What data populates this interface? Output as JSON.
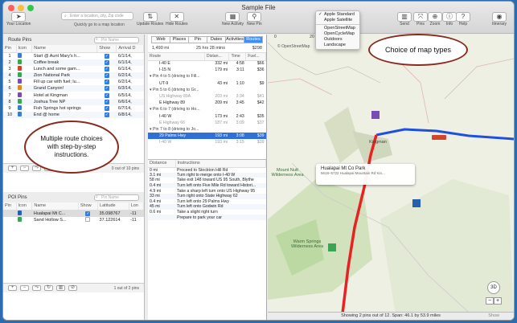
{
  "window": {
    "title": "Sample File"
  },
  "toolbar": {
    "your_location": "Your Location",
    "search_placeholder": "Enter a location, city, Zip code",
    "search_caption": "Quickly go to a map location",
    "update_routes": "Update Routes",
    "hide_routes": "Hide Routes",
    "new_activity": "New Activity",
    "new_pin": "New Pin",
    "send": "Send",
    "pins": "Pins",
    "zoom": "Zoom",
    "info": "Info",
    "help": "Help",
    "itinerary": "Itinerary"
  },
  "route_pins": {
    "title": "Route Pins",
    "search_placeholder": "Pin Name",
    "columns": [
      "Pin",
      "Icon",
      "Name",
      "Show",
      "Arrival D"
    ],
    "rows": [
      {
        "pin": "1",
        "name": "Start @ Aunt Mary's h...",
        "date": "6/1/14, ",
        "color": "#3a7bd5"
      },
      {
        "pin": "2",
        "name": "Coffee break",
        "date": "6/1/14, ",
        "color": "#3aa655"
      },
      {
        "pin": "3",
        "name": "Lunch and some gam...",
        "date": "6/1/14, ",
        "color": "#d2452c"
      },
      {
        "pin": "4",
        "name": "Zion National Park",
        "date": "6/2/14, ",
        "color": "#3aa655"
      },
      {
        "pin": "5",
        "name": "Fill up car with fuel; lu...",
        "date": "6/2/14, ",
        "color": "#7a4bb5"
      },
      {
        "pin": "6",
        "name": "Grand Canyon!",
        "date": "6/3/14, ",
        "color": "#e08a1e"
      },
      {
        "pin": "7",
        "name": "Hotel at Kingman",
        "date": "6/5/14, ",
        "color": "#7a4bb5"
      },
      {
        "pin": "8",
        "name": "Joshua Tree NP",
        "date": "6/6/14, ",
        "color": "#3aa655"
      },
      {
        "pin": "9",
        "name": "Fish Springs hot springs",
        "date": "6/7/14, ",
        "color": "#3a7bd5"
      },
      {
        "pin": "10",
        "name": "End @ home",
        "date": "6/8/14, ",
        "color": "#3a7bd5"
      }
    ],
    "footer": "0 out of 10 pins"
  },
  "poi_pins": {
    "title": "POI Pins",
    "search_placeholder": "Pin Name",
    "columns": [
      "Pin",
      "Icon",
      "Name",
      "Show",
      "Latitude",
      "Lon"
    ],
    "rows": [
      {
        "name": "Hualapai Mt C...",
        "lat": "35.098767",
        "lon": "-11"
      },
      {
        "name": "Sand Hollow S...",
        "lat": "37.122614",
        "lon": "-11"
      }
    ],
    "footer": "1 out of 2 pins"
  },
  "route_panel": {
    "tabs": [
      "Web",
      "Places",
      "Pin",
      "Dates",
      "Activities",
      "Routes"
    ],
    "active_tab": "Routes",
    "summary": {
      "miles": "1,490 mi",
      "time": "25 hrs 28 mins",
      "cost": "$298"
    },
    "columns": [
      "Route",
      "Distan...",
      "Time",
      "Fuel..."
    ],
    "rows": [
      {
        "type": "row",
        "route": "I-40 E",
        "dist": "332 mi",
        "time": "4:58",
        "fuel": "$66"
      },
      {
        "type": "row",
        "route": "I-15 N",
        "dist": "179 mi",
        "time": "3:11",
        "fuel": "$36"
      },
      {
        "type": "hdr",
        "route": "Pin 4 to 5 (driving to Fill..."
      },
      {
        "type": "row",
        "route": "UT-9",
        "dist": "43 mi",
        "time": "1:10",
        "fuel": "$9"
      },
      {
        "type": "hdr",
        "route": "Pin 5 to 6 (driving to Gr..."
      },
      {
        "type": "dim",
        "route": "US Highway 89A",
        "dist": "203 mi",
        "time": "3:34",
        "fuel": "$41"
      },
      {
        "type": "row",
        "route": "E Highway 89",
        "dist": "209 mi",
        "time": "3:45",
        "fuel": "$42"
      },
      {
        "type": "hdr",
        "route": "Pin 6 to 7 (driving to Ho..."
      },
      {
        "type": "row",
        "route": "I-40 W",
        "dist": "173 mi",
        "time": "2:43",
        "fuel": "$35"
      },
      {
        "type": "dim",
        "route": "E Highway 66",
        "dist": "187 mi",
        "time": "3:09",
        "fuel": "$37"
      },
      {
        "type": "hdr",
        "route": "Pin 7 to 8 (driving to Jo..."
      },
      {
        "type": "sel",
        "route": "29 Palms Hwy",
        "dist": "193 mi",
        "time": "3:08",
        "fuel": "$39"
      },
      {
        "type": "dim",
        "route": "I-40 W",
        "dist": "193 mi",
        "time": "3:15",
        "fuel": "$39"
      }
    ],
    "step_columns": [
      "Distance",
      "Instructions"
    ],
    "steps": [
      {
        "d": "0 mi",
        "i": "Proceed to Stockton Hill Rd"
      },
      {
        "d": "3.1 mi",
        "i": "Turn right to merge onto I-40 W"
      },
      {
        "d": "58 mi",
        "i": "Take exit 148 toward US 95 South, Blythe"
      },
      {
        "d": "0.4 mi",
        "i": "Turn left onto Five Mile Rd toward Histori..."
      },
      {
        "d": "4.9 mi",
        "i": "Take a sharp left turn onto US Highway 95"
      },
      {
        "d": "33 mi",
        "i": "Turn right onto State Highway 62"
      },
      {
        "d": "0.4 mi",
        "i": "Turn left onto 29 Palms Hwy"
      },
      {
        "d": "45 mi",
        "i": "Turn left onto Godwin Rd"
      },
      {
        "d": "0.6 mi",
        "i": "Take a slight right turn"
      },
      {
        "d": "",
        "i": "Prepare to park your car"
      }
    ]
  },
  "map_menu": {
    "items": [
      "Apple Standard",
      "Apple Satellite",
      "OpenStreetMap",
      "OpenCycleMap",
      "Outdoors",
      "Landscape"
    ],
    "selected": "Apple Standard"
  },
  "map": {
    "attribution": "© OpenStreetMap",
    "callout_title": "Hualapai Mt Co Park",
    "callout_address": "6618–5722 Hualapai Mountain Rd Kin...",
    "labels": [
      "Mount Nutt Wilderness Area",
      "Warm Springs Wilderness Area",
      "Kingman"
    ],
    "scale": [
      "0",
      "20"
    ],
    "btn_3d": "3D",
    "zoom_in": "+",
    "zoom_out": "−",
    "status": "Showing 2 pins out of 12. Span: 46.1 by 53.9 miles",
    "status_right": "Show",
    "route_colors": {
      "selected": "#e82222",
      "other": "#1f4fe0"
    }
  },
  "annotations": {
    "route_choices": "Multiple route choices with step-by-step instructions.",
    "map_types": "Choice of map types"
  }
}
